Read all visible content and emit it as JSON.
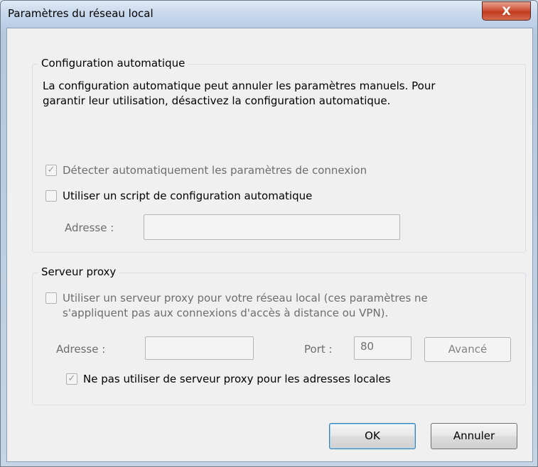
{
  "window": {
    "title": "Paramètres du réseau local",
    "close_label": "X"
  },
  "auto_config": {
    "group_label": "Configuration automatique",
    "description_line1": "La configuration automatique peut annuler les paramètres manuels. Pour",
    "description_line2": "garantir leur utilisation, désactivez la configuration automatique.",
    "detect_label": "Détecter automatiquement les paramètres de connexion",
    "detect_checked": true,
    "script_label": "Utiliser un script de configuration automatique",
    "script_checked": false,
    "address_label": "Adresse :",
    "address_value": ""
  },
  "proxy": {
    "group_label": "Serveur proxy",
    "use_proxy_line1": "Utiliser un serveur proxy pour votre réseau local (ces paramètres ne",
    "use_proxy_line2": "s'appliquent pas aux connexions d'accès à distance ou VPN).",
    "use_proxy_checked": false,
    "address_label": "Adresse :",
    "address_value": "",
    "port_label": "Port :",
    "port_value": "80",
    "advanced_label": "Avancé",
    "bypass_label": "Ne pas utiliser de serveur proxy pour les adresses locales",
    "bypass_checked": true
  },
  "buttons": {
    "ok_label": "OK",
    "cancel_label": "Annuler"
  }
}
